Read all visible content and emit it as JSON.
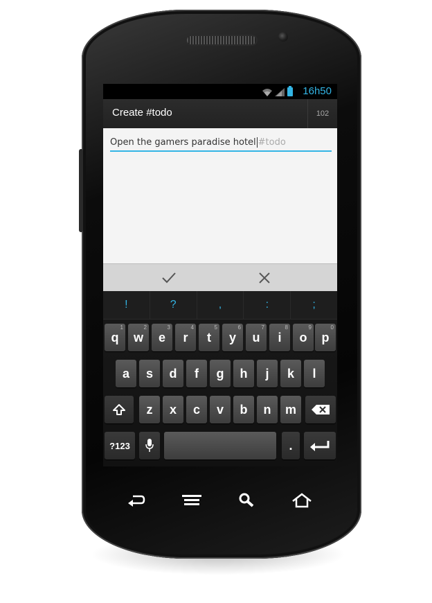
{
  "status_bar": {
    "time": "16h50",
    "icons": [
      "wifi-icon",
      "signal-icon",
      "battery-icon"
    ]
  },
  "action_bar": {
    "title": "Create #todo",
    "char_counter": "102"
  },
  "editor": {
    "text": "Open the gamers paradise hotel",
    "hashtag_hint": "#todo"
  },
  "actions": {
    "confirm_icon": "check-icon",
    "cancel_icon": "close-icon"
  },
  "keyboard": {
    "suggestions": [
      "!",
      "?",
      ",",
      ":",
      ";"
    ],
    "row1": [
      {
        "key": "q",
        "hint": "1"
      },
      {
        "key": "w",
        "hint": "2"
      },
      {
        "key": "e",
        "hint": "3"
      },
      {
        "key": "r",
        "hint": "4"
      },
      {
        "key": "t",
        "hint": "5"
      },
      {
        "key": "y",
        "hint": "6"
      },
      {
        "key": "u",
        "hint": "7"
      },
      {
        "key": "i",
        "hint": "8"
      },
      {
        "key": "o",
        "hint": "9"
      },
      {
        "key": "p",
        "hint": "0"
      }
    ],
    "row2": [
      "a",
      "s",
      "d",
      "f",
      "g",
      "h",
      "j",
      "k",
      "l"
    ],
    "row3": [
      "z",
      "x",
      "c",
      "v",
      "b",
      "n",
      "m"
    ],
    "symbols_key": "?123",
    "period_key": "."
  },
  "colors": {
    "accent": "#33b5e5",
    "screen_bg": "#f4f4f4",
    "keyboard_bg": "#111111"
  }
}
